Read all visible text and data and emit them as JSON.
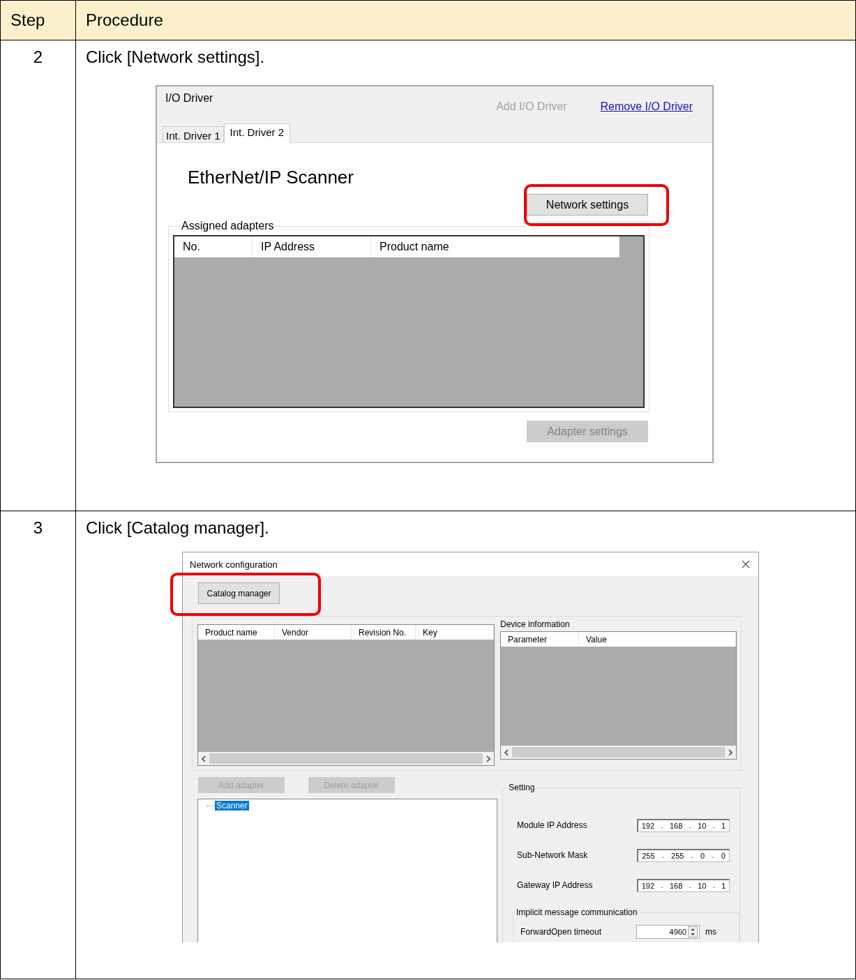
{
  "table": {
    "columns": [
      "Step",
      "Procedure"
    ],
    "rows": [
      {
        "step": "2",
        "instruction": "Click [Network settings].",
        "screen": {
          "kind": "io_driver",
          "title": "I/O Driver",
          "links": [
            {
              "label": "Add I/O Driver",
              "disabled": true
            },
            {
              "label": "Remove I/O Driver",
              "disabled": false
            }
          ],
          "tabs": [
            {
              "label": "Int. Driver 1",
              "selected": false
            },
            {
              "label": "Int. Driver 2",
              "selected": true
            }
          ],
          "heading": "EtherNet/IP Scanner",
          "settings_button": {
            "label": "Network settings",
            "highlighted": true
          },
          "group": {
            "label": "Assigned adapters",
            "columns": [
              "No.",
              "IP Address",
              "Product name"
            ]
          },
          "adapter_button": {
            "label": "Adapter settings",
            "disabled": true
          }
        }
      },
      {
        "step": "3",
        "instruction": "Click [Catalog manager].",
        "screen": {
          "kind": "network_config",
          "title": "Network configuration",
          "catalog_button": {
            "label": "Catalog manager",
            "highlighted": true
          },
          "eds_columns": [
            "Product name",
            "Vendor",
            "Revision No.",
            "Key"
          ],
          "device_information": {
            "label": "Device information",
            "columns": [
              "Parameter",
              "Value"
            ]
          },
          "adapter_buttons": [
            {
              "label": "Add adapter",
              "disabled": true
            },
            {
              "label": "Delete adapter",
              "disabled": true
            }
          ],
          "tree": [
            {
              "label": "Scanner",
              "selected": true
            }
          ],
          "setting": {
            "label": "Setting",
            "separator": ".",
            "fields": [
              {
                "label": "Module IP Address",
                "octets": [
                  "192",
                  "168",
                  "10",
                  "1"
                ]
              },
              {
                "label": "Sub-Network Mask",
                "octets": [
                  "255",
                  "255",
                  "0",
                  "0"
                ]
              },
              {
                "label": "Gateway IP Address",
                "octets": [
                  "192",
                  "168",
                  "10",
                  "1"
                ]
              }
            ],
            "implicit": {
              "label": "Implicit message communication",
              "timeout": {
                "label": "ForwardOpen timeout",
                "value": "4960",
                "unit": "ms"
              }
            }
          }
        }
      }
    ]
  }
}
